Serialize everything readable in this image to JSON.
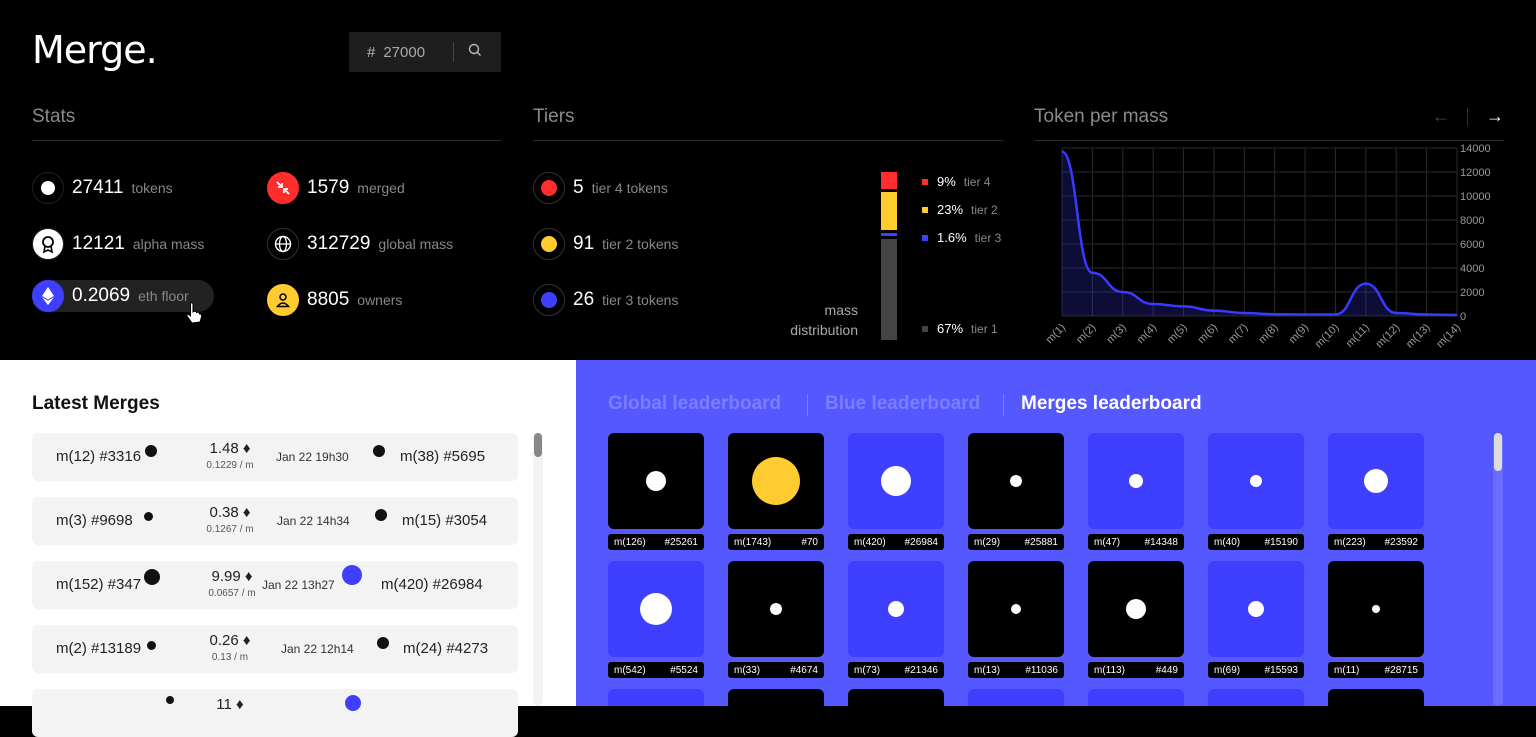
{
  "app": {
    "logo": "Merge."
  },
  "search": {
    "hash": "#",
    "value": "27000"
  },
  "stats": {
    "title": "Stats",
    "items": [
      {
        "value": "27411",
        "label": "tokens"
      },
      {
        "value": "12121",
        "label": "alpha mass"
      },
      {
        "value": "0.2069",
        "label": "eth floor"
      },
      {
        "value": "1579",
        "label": "merged"
      },
      {
        "value": "312729",
        "label": "global mass"
      },
      {
        "value": "8805",
        "label": "owners"
      }
    ]
  },
  "tiers": {
    "title": "Tiers",
    "items": [
      {
        "value": "5",
        "label": "tier 4 tokens",
        "color": "#ff2d2d"
      },
      {
        "value": "91",
        "label": "tier 2 tokens",
        "color": "#ffcb2f"
      },
      {
        "value": "26",
        "label": "tier 3 tokens",
        "color": "#3f3fff"
      }
    ],
    "mass_label_1": "mass",
    "mass_label_2": "distribution",
    "legend": [
      {
        "pct": "9%",
        "tier": "tier 4",
        "color": "#ff2d2d"
      },
      {
        "pct": "23%",
        "tier": "tier 2",
        "color": "#ffcb2f"
      },
      {
        "pct": "1.6%",
        "tier": "tier 3",
        "color": "#3f3fff"
      },
      {
        "pct": "67%",
        "tier": "tier 1",
        "color": "#444444"
      }
    ]
  },
  "token_chart": {
    "title": "Token per mass",
    "prev": "←",
    "next": "→"
  },
  "chart_data": {
    "type": "area",
    "title": "Token per mass",
    "x": [
      "m(1)",
      "m(2)",
      "m(3)",
      "m(4)",
      "m(5)",
      "m(6)",
      "m(7)",
      "m(8)",
      "m(9)",
      "m(10)",
      "m(11)",
      "m(12)",
      "m(13)",
      "m(14)"
    ],
    "y_ticks": [
      0,
      2000,
      4000,
      6000,
      8000,
      10000,
      12000,
      14000
    ],
    "ylim": [
      0,
      14000
    ],
    "series": [
      {
        "values": [
          13700,
          3600,
          2000,
          1000,
          800,
          450,
          250,
          150,
          120,
          120,
          2700,
          250,
          120,
          80
        ],
        "color": "#3a3aff"
      }
    ],
    "grid": true
  },
  "latest": {
    "title": "Latest Merges",
    "rows": [
      {
        "from": "m(12) #3316",
        "mass": "1.48",
        "ratio": "0.1229 / m",
        "date": "Jan 22 19h30",
        "to": "m(38) #5695",
        "fromColor": "#111",
        "toColor": "#111"
      },
      {
        "from": "m(3) #9698",
        "mass": "0.38",
        "ratio": "0.1267 / m",
        "date": "Jan 22 14h34",
        "to": "m(15) #3054",
        "fromColor": "#111",
        "toColor": "#111"
      },
      {
        "from": "m(152) #347",
        "mass": "9.99",
        "ratio": "0.0657 / m",
        "date": "Jan 22 13h27",
        "to": "m(420) #26984",
        "fromColor": "#111",
        "toColor": "#3f3fff"
      },
      {
        "from": "m(2) #13189",
        "mass": "0.26",
        "ratio": "0.13 / m",
        "date": "Jan 22 12h14",
        "to": "m(24) #4273",
        "fromColor": "#111",
        "toColor": "#111"
      },
      {
        "from": "",
        "mass": "11",
        "ratio": "",
        "date": "",
        "to": "",
        "fromColor": "#111",
        "toColor": "#3f3fff"
      }
    ]
  },
  "leaderboard": {
    "tabs": [
      "Global leaderboard",
      "Blue leaderboard",
      "Merges leaderboard"
    ],
    "tiles": [
      {
        "m": "m(126)",
        "id": "#25261",
        "bg": "#000"
      },
      {
        "m": "m(1743)",
        "id": "#70",
        "bg": "#000",
        "dotColor": "#ffcb2f"
      },
      {
        "m": "m(420)",
        "id": "#26984",
        "bg": "#3f3fff"
      },
      {
        "m": "m(29)",
        "id": "#25881",
        "bg": "#000"
      },
      {
        "m": "m(47)",
        "id": "#14348",
        "bg": "#3f3fff"
      },
      {
        "m": "m(40)",
        "id": "#15190",
        "bg": "#3f3fff"
      },
      {
        "m": "m(223)",
        "id": "#23592",
        "bg": "#3f3fff"
      },
      {
        "m": "m(542)",
        "id": "#5524",
        "bg": "#3f3fff"
      },
      {
        "m": "m(33)",
        "id": "#4674",
        "bg": "#000"
      },
      {
        "m": "m(73)",
        "id": "#21346",
        "bg": "#3f3fff"
      },
      {
        "m": "m(13)",
        "id": "#11036",
        "bg": "#000"
      },
      {
        "m": "m(113)",
        "id": "#449",
        "bg": "#000"
      },
      {
        "m": "m(69)",
        "id": "#15593",
        "bg": "#3f3fff"
      },
      {
        "m": "m(11)",
        "id": "#28715",
        "bg": "#000"
      }
    ]
  }
}
